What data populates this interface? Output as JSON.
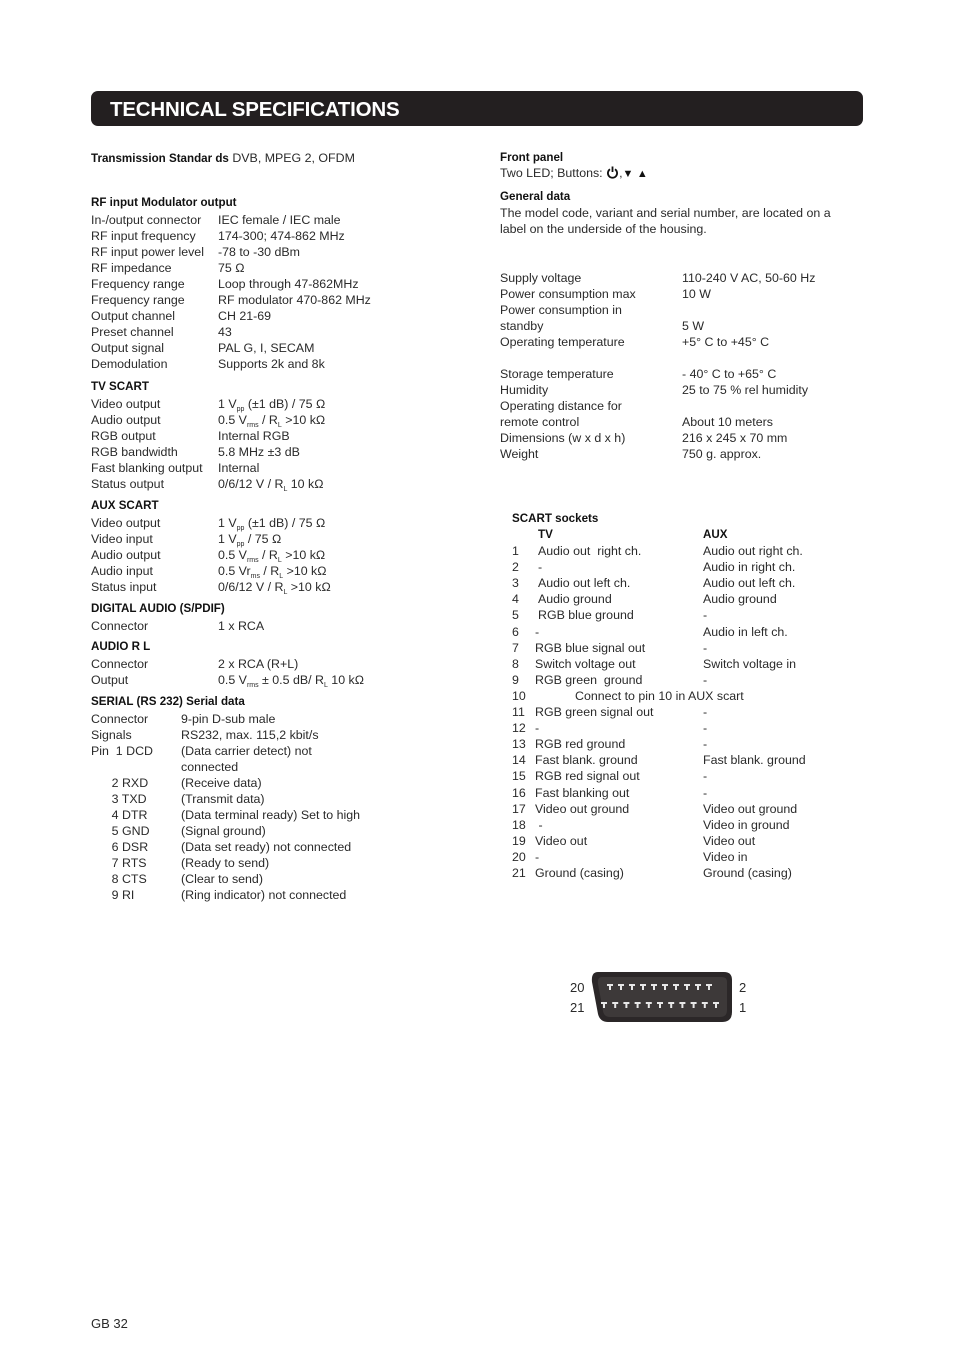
{
  "title": "TECHNICAL SPECIFICATIONS",
  "transmission": {
    "label": "Transmission Standar ds",
    "value": "DVB, MPEG 2, OFDM"
  },
  "rf": {
    "heading": "RF input Modulator output",
    "rows": [
      {
        "label": "In-/output connector",
        "value": "IEC female / IEC male"
      },
      {
        "label": "RF input frequency",
        "value": "174-300; 474-862 MHz"
      },
      {
        "label": "RF input power level",
        "value": "-78 to -30 dBm"
      },
      {
        "label": "RF impedance",
        "value": "75 Ω"
      },
      {
        "label": "Frequency range",
        "value": "Loop through 47-862MHz"
      },
      {
        "label": "Frequency range",
        "value": "RF modulator 470-862 MHz"
      },
      {
        "label": "Output channel",
        "value": "CH 21-69"
      },
      {
        "label": "Preset channel",
        "value": "43"
      },
      {
        "label": "Output signal",
        "value": "PAL G, I, SECAM"
      },
      {
        "label": "Demodulation",
        "value": "Supports 2k and 8k"
      }
    ]
  },
  "tv_scart": {
    "heading": "TV SCART",
    "rows": [
      {
        "label": "Video output",
        "pre": "1 V",
        "sub": "pp",
        "post": " (±1 dB) / 75 Ω"
      },
      {
        "label": "Audio output",
        "pre": "0.5 V",
        "sub": "rms",
        "post": " / R",
        "sub2": "L",
        "post2": " >10 kΩ"
      },
      {
        "label": "RGB output",
        "pre": "Internal RGB"
      },
      {
        "label": "RGB bandwidth",
        "pre": "5.8 MHz ±3 dB"
      },
      {
        "label": "Fast blanking output",
        "pre": "Internal"
      },
      {
        "label": "Status output",
        "pre": "0/6/12 V /  R",
        "sub": "L",
        "post": " 10 kΩ"
      }
    ]
  },
  "aux_scart": {
    "heading": "AUX SCART",
    "rows": [
      {
        "label": "Video output",
        "pre": "1 V",
        "sub": "pp",
        "post": " (±1 dB) / 75 Ω"
      },
      {
        "label": "Video input",
        "pre": "1 V",
        "sub": "pp",
        "post": " / 75  Ω"
      },
      {
        "label": "Audio output",
        "pre": "0.5 V",
        "sub": "rms",
        "post": " / R",
        "sub2": "L",
        "post2": " >10 kΩ"
      },
      {
        "label": "Audio input",
        "pre": "0.5 Vr",
        "sub": "ms",
        "post": " / R",
        "sub2": "L",
        "post2": " >10 kΩ"
      },
      {
        "label": "Status input",
        "pre": "0/6/12 V /  R",
        "sub": "L",
        "post": " >10 kΩ"
      }
    ]
  },
  "digital_audio": {
    "heading": "DIGITAL AUDIO (S/PDIF)",
    "rows": [
      {
        "label": "Connector",
        "value": "1 x RCA"
      }
    ]
  },
  "audio_rl": {
    "heading": "AUDIO  R  L",
    "rows": [
      {
        "label": "Connector",
        "pre": "2 x RCA (R+L)"
      },
      {
        "label": "Output",
        "pre": "0.5 V",
        "sub": "rms",
        "post": " ±  0.5 dB/ R",
        "sub2": "L",
        "post2": " 10 kΩ"
      }
    ]
  },
  "serial": {
    "heading": "SERIAL (RS 232) Serial data",
    "rows": [
      {
        "label": "Connector",
        "value": "9-pin D-sub male"
      },
      {
        "label": "Signals",
        "value": "RS232, max. 115,2 kbit/s"
      },
      {
        "label": "Pin  1 DCD",
        "value": "(Data carrier detect) not"
      },
      {
        "label": "",
        "value": "connected"
      },
      {
        "label": "      2 RXD",
        "value": "(Receive data)"
      },
      {
        "label": "      3 TXD",
        "value": "(Transmit data)"
      },
      {
        "label": "      4 DTR",
        "value": "(Data terminal ready) Set to high"
      },
      {
        "label": "      5 GND",
        "value": "(Signal ground)"
      },
      {
        "label": "      6 DSR",
        "value": "(Data set ready) not connected"
      },
      {
        "label": "      7 RTS",
        "value": "(Ready to send)"
      },
      {
        "label": "      8 CTS",
        "value": "(Clear to send)"
      },
      {
        "label": "      9 RI",
        "value": "(Ring indicator) not connected"
      }
    ]
  },
  "front_panel": {
    "heading": "Front panel",
    "text": "Two LED; Buttons:",
    "icons": [
      "power-icon",
      "down-triangle-icon",
      "up-triangle-icon"
    ]
  },
  "general": {
    "heading": "General data",
    "line1": "The model code, variant and serial number, are located on a",
    "line2": "label on the underside of the housing.",
    "rows": [
      {
        "label": "Supply voltage",
        "value": "110-240 V AC, 50-60 Hz"
      },
      {
        "label": "Power consumption max",
        "value": "10 W"
      },
      {
        "label": "Power consumption in",
        "value": ""
      },
      {
        "label": "standby",
        "value": "5 W"
      },
      {
        "label": "Operating temperature",
        "value": "+5° C to +45° C"
      },
      {
        "label": "",
        "value": ""
      },
      {
        "label": "Storage temperature",
        "value": "- 40° C to +65° C"
      },
      {
        "label": "Humidity",
        "value": "25 to 75 % rel humidity"
      },
      {
        "label": "Operating distance for",
        "value": ""
      },
      {
        "label": "remote control",
        "value": "About 10 meters"
      },
      {
        "label": "Dimensions (w x d x h)",
        "value": "216 x 245 x 70 mm"
      },
      {
        "label": "Weight",
        "value": "750 g. approx."
      }
    ]
  },
  "scart": {
    "heading": "SCART sockets",
    "col_tv": "TV",
    "col_aux": "AUX",
    "pins": [
      {
        "n": "1",
        "tv": "Audio out  right ch.",
        "aux": "Audio out right ch."
      },
      {
        "n": "2",
        "tv": "-",
        "aux": "Audio in right ch."
      },
      {
        "n": "3",
        "tv": "Audio out left ch.",
        "aux": "Audio out left ch."
      },
      {
        "n": "4",
        "tv": "Audio ground",
        "aux": "Audio ground"
      },
      {
        "n": "5",
        "tv": "RGB blue ground",
        "aux": "-"
      },
      {
        "n": "6",
        "tv": "-",
        "aux": "Audio in left ch."
      },
      {
        "n": "7",
        "tv": "RGB blue signal out",
        "aux": "-"
      },
      {
        "n": "8",
        "tv": "Switch voltage out",
        "aux": "Switch voltage in"
      },
      {
        "n": "9",
        "tv": "RGB green  ground",
        "aux": "-"
      },
      {
        "n": "10",
        "span": "Connect to pin 10 in AUX scart"
      },
      {
        "n": "11",
        "tv": "RGB green signal out",
        "aux": "-"
      },
      {
        "n": "12",
        "tv": "-",
        "aux": "-"
      },
      {
        "n": "13",
        "tv": "RGB red ground",
        "aux": "-"
      },
      {
        "n": "14",
        "tv": "Fast blank. ground",
        "aux": "Fast blank. ground"
      },
      {
        "n": "15",
        "tv": "RGB red signal out",
        "aux": "-"
      },
      {
        "n": "16",
        "tv": "Fast blanking out",
        "aux": "-"
      },
      {
        "n": "17",
        "tv": "Video out ground",
        "aux": "Video out ground"
      },
      {
        "n": "18",
        "tv": " -",
        "aux": "Video in ground"
      },
      {
        "n": "19",
        "tv": "Video out",
        "aux": "Video out"
      },
      {
        "n": "20",
        "tv": "-",
        "aux": "Video in"
      },
      {
        "n": "21",
        "tv": "Ground (casing)",
        "aux": "Ground (casing)"
      }
    ],
    "connector": {
      "top_left": "20",
      "bottom_left": "21",
      "top_right": "2",
      "bottom_right": "1",
      "top_pins": 10,
      "bottom_pins": 11
    }
  },
  "footer": "GB 32"
}
